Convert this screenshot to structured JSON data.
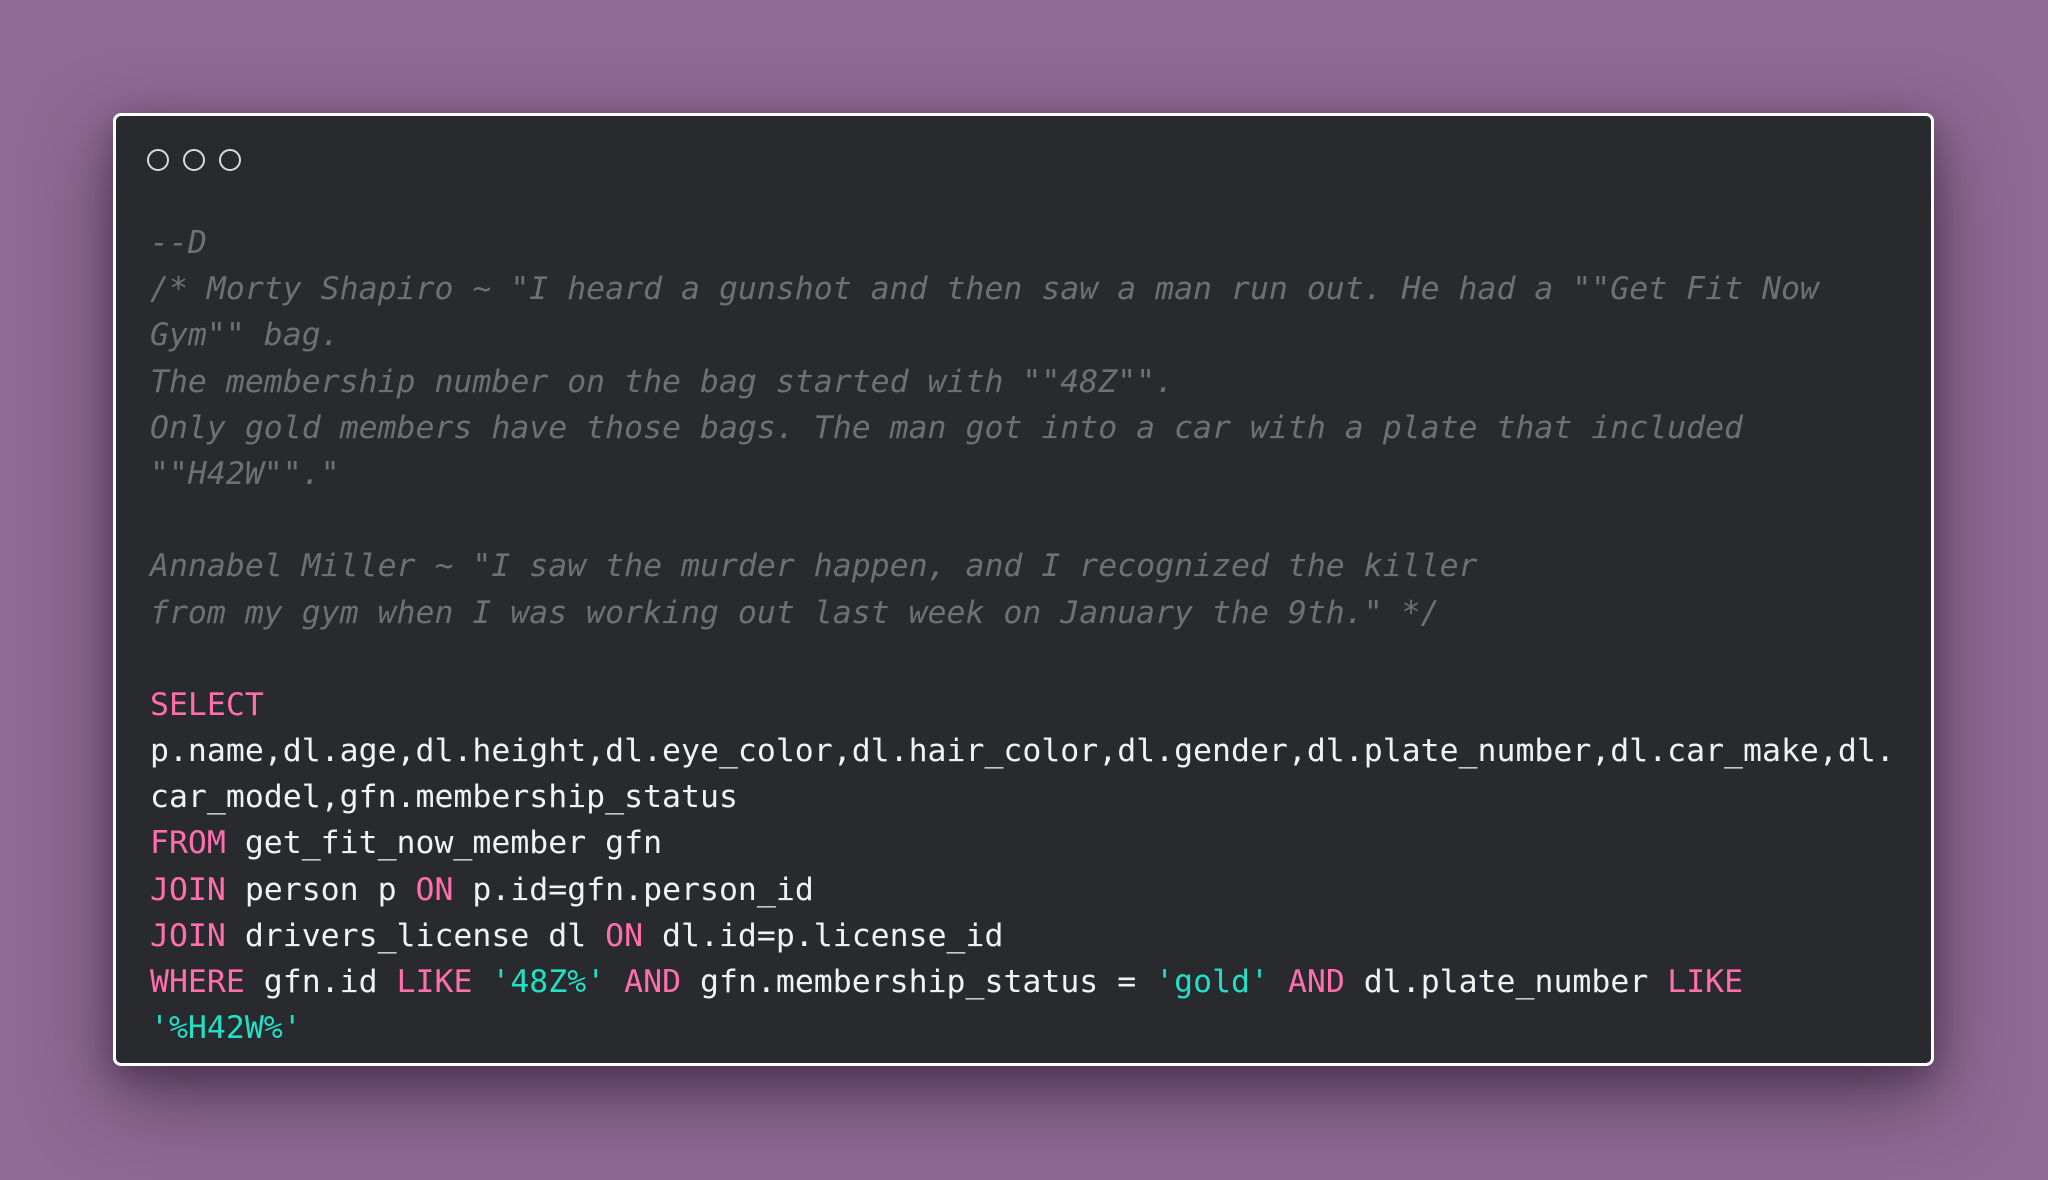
{
  "window": {
    "controls": [
      "close",
      "minimize",
      "maximize"
    ]
  },
  "colors": {
    "background": "#8f6a94",
    "window": "#282a2e",
    "comment": "#6e7073",
    "keyword": "#ff6fae",
    "string": "#22e0c6",
    "text": "#f2f2f2"
  },
  "code": {
    "lines": [
      [
        {
          "t": "cm",
          "v": "--D"
        }
      ],
      [
        {
          "t": "cm",
          "v": "/* Morty Shapiro ~ \"I heard a gunshot and then saw a man run out. He had a \"\"Get Fit Now"
        }
      ],
      [
        {
          "t": "cm",
          "v": "Gym\"\" bag."
        }
      ],
      [
        {
          "t": "cm",
          "v": "The membership number on the bag started with \"\"48Z\"\"."
        }
      ],
      [
        {
          "t": "cm",
          "v": "Only gold members have those bags. The man got into a car with a plate that included"
        }
      ],
      [
        {
          "t": "cm",
          "v": "\"\"H42W\"\".\""
        }
      ],
      [],
      [
        {
          "t": "cm",
          "v": "Annabel Miller ~ \"I saw the murder happen, and I recognized the killer"
        }
      ],
      [
        {
          "t": "cm",
          "v": "from my gym when I was working out last week on January the 9th.\" */"
        }
      ],
      [],
      [
        {
          "t": "kw",
          "v": "SELECT"
        }
      ],
      [
        {
          "t": "tx",
          "v": "p.name,dl.age,dl.height,dl.eye_color,dl.hair_color,dl.gender,dl.plate_number,dl.car_make,dl."
        }
      ],
      [
        {
          "t": "tx",
          "v": "car_model,gfn.membership_status"
        }
      ],
      [
        {
          "t": "kw",
          "v": "FROM"
        },
        {
          "t": "tx",
          "v": " get_fit_now_member gfn"
        }
      ],
      [
        {
          "t": "kw",
          "v": "JOIN"
        },
        {
          "t": "tx",
          "v": " person p "
        },
        {
          "t": "kw",
          "v": "ON"
        },
        {
          "t": "tx",
          "v": " p.id=gfn.person_id"
        }
      ],
      [
        {
          "t": "kw",
          "v": "JOIN"
        },
        {
          "t": "tx",
          "v": " drivers_license dl "
        },
        {
          "t": "kw",
          "v": "ON"
        },
        {
          "t": "tx",
          "v": " dl.id=p.license_id"
        }
      ],
      [
        {
          "t": "kw",
          "v": "WHERE"
        },
        {
          "t": "tx",
          "v": " gfn.id "
        },
        {
          "t": "kw",
          "v": "LIKE"
        },
        {
          "t": "tx",
          "v": " "
        },
        {
          "t": "str",
          "v": "'48Z%'"
        },
        {
          "t": "tx",
          "v": " "
        },
        {
          "t": "kw",
          "v": "AND"
        },
        {
          "t": "tx",
          "v": " gfn.membership_status = "
        },
        {
          "t": "str",
          "v": "'gold'"
        },
        {
          "t": "tx",
          "v": " "
        },
        {
          "t": "kw",
          "v": "AND"
        },
        {
          "t": "tx",
          "v": " dl.plate_number "
        },
        {
          "t": "kw",
          "v": "LIKE"
        }
      ],
      [
        {
          "t": "str",
          "v": "'%H42W%'"
        }
      ]
    ]
  }
}
